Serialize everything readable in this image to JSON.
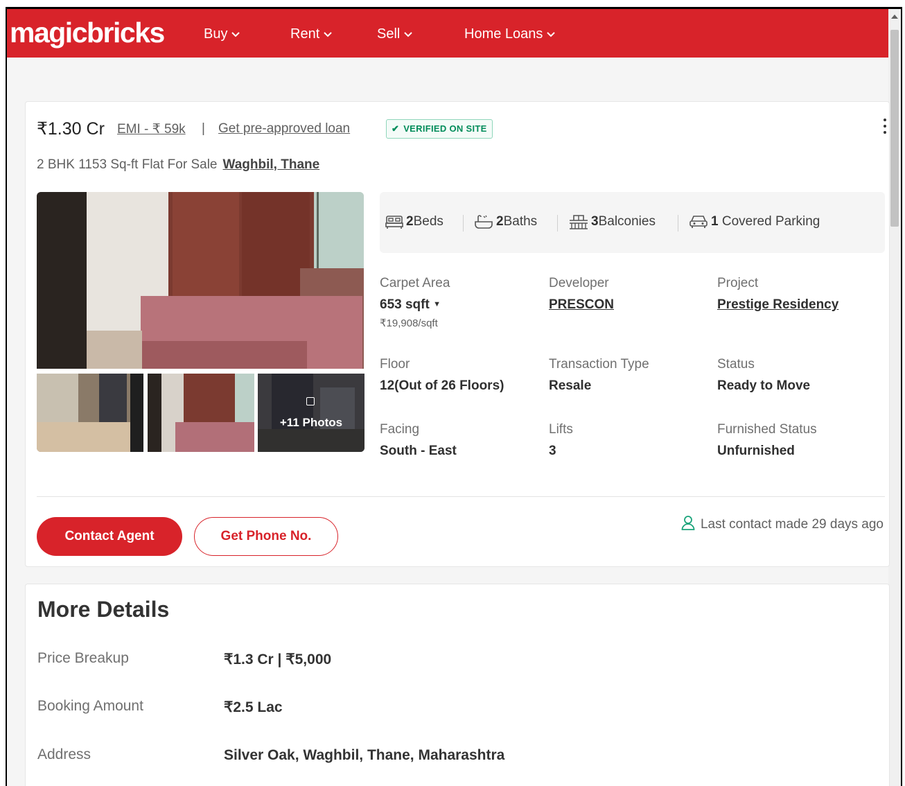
{
  "nav": {
    "logo": "magicbricks",
    "items": [
      {
        "label": "Buy"
      },
      {
        "label": "Rent"
      },
      {
        "label": "Sell"
      },
      {
        "label": "Home Loans"
      }
    ]
  },
  "listing": {
    "price": "₹1.30 Cr",
    "emi": "EMI - ₹ 59k",
    "separator": "|",
    "loan_link": "Get pre-approved loan",
    "verified_badge": "VERIFIED ON SITE",
    "subtitle": "2 BHK 1153 Sq-ft Flat For Sale",
    "location": "Waghbil, Thane",
    "photos_more": "+11 Photos",
    "amenities": [
      {
        "count": "2",
        "label": "Beds",
        "icon": "bed-icon"
      },
      {
        "count": "2",
        "label": "Baths",
        "icon": "bath-icon"
      },
      {
        "count": "3",
        "label": "Balconies",
        "icon": "balcony-icon"
      },
      {
        "count": "1",
        "label": "Covered Parking",
        "icon": "car-icon"
      }
    ],
    "specs": {
      "carpet_area": {
        "label": "Carpet Area",
        "value": "653 sqft",
        "sub": "₹19,908/sqft"
      },
      "developer": {
        "label": "Developer",
        "value": "PRESCON"
      },
      "project": {
        "label": "Project",
        "value": "Prestige Residency"
      },
      "floor": {
        "label": "Floor",
        "value": "12(Out of 26 Floors)"
      },
      "transaction": {
        "label": "Transaction Type",
        "value": "Resale"
      },
      "status": {
        "label": "Status",
        "value": "Ready to Move"
      },
      "facing": {
        "label": "Facing",
        "value": "South - East"
      },
      "lifts": {
        "label": "Lifts",
        "value": "3"
      },
      "furnished": {
        "label": "Furnished Status",
        "value": "Unfurnished"
      }
    },
    "contact_button": "Contact Agent",
    "phone_button": "Get Phone No.",
    "last_contact": "Last contact made 29 days ago"
  },
  "more_details": {
    "title": "More Details",
    "rows": [
      {
        "label": "Price Breakup",
        "value": "₹1.3 Cr | ₹5,000"
      },
      {
        "label": "Booking Amount",
        "value": "₹2.5 Lac"
      },
      {
        "label": "Address",
        "value": "Silver Oak, Waghbil, Thane, Maharashtra"
      }
    ]
  },
  "colors": {
    "brand_red": "#d8232a",
    "verified_green": "#008c5a"
  }
}
